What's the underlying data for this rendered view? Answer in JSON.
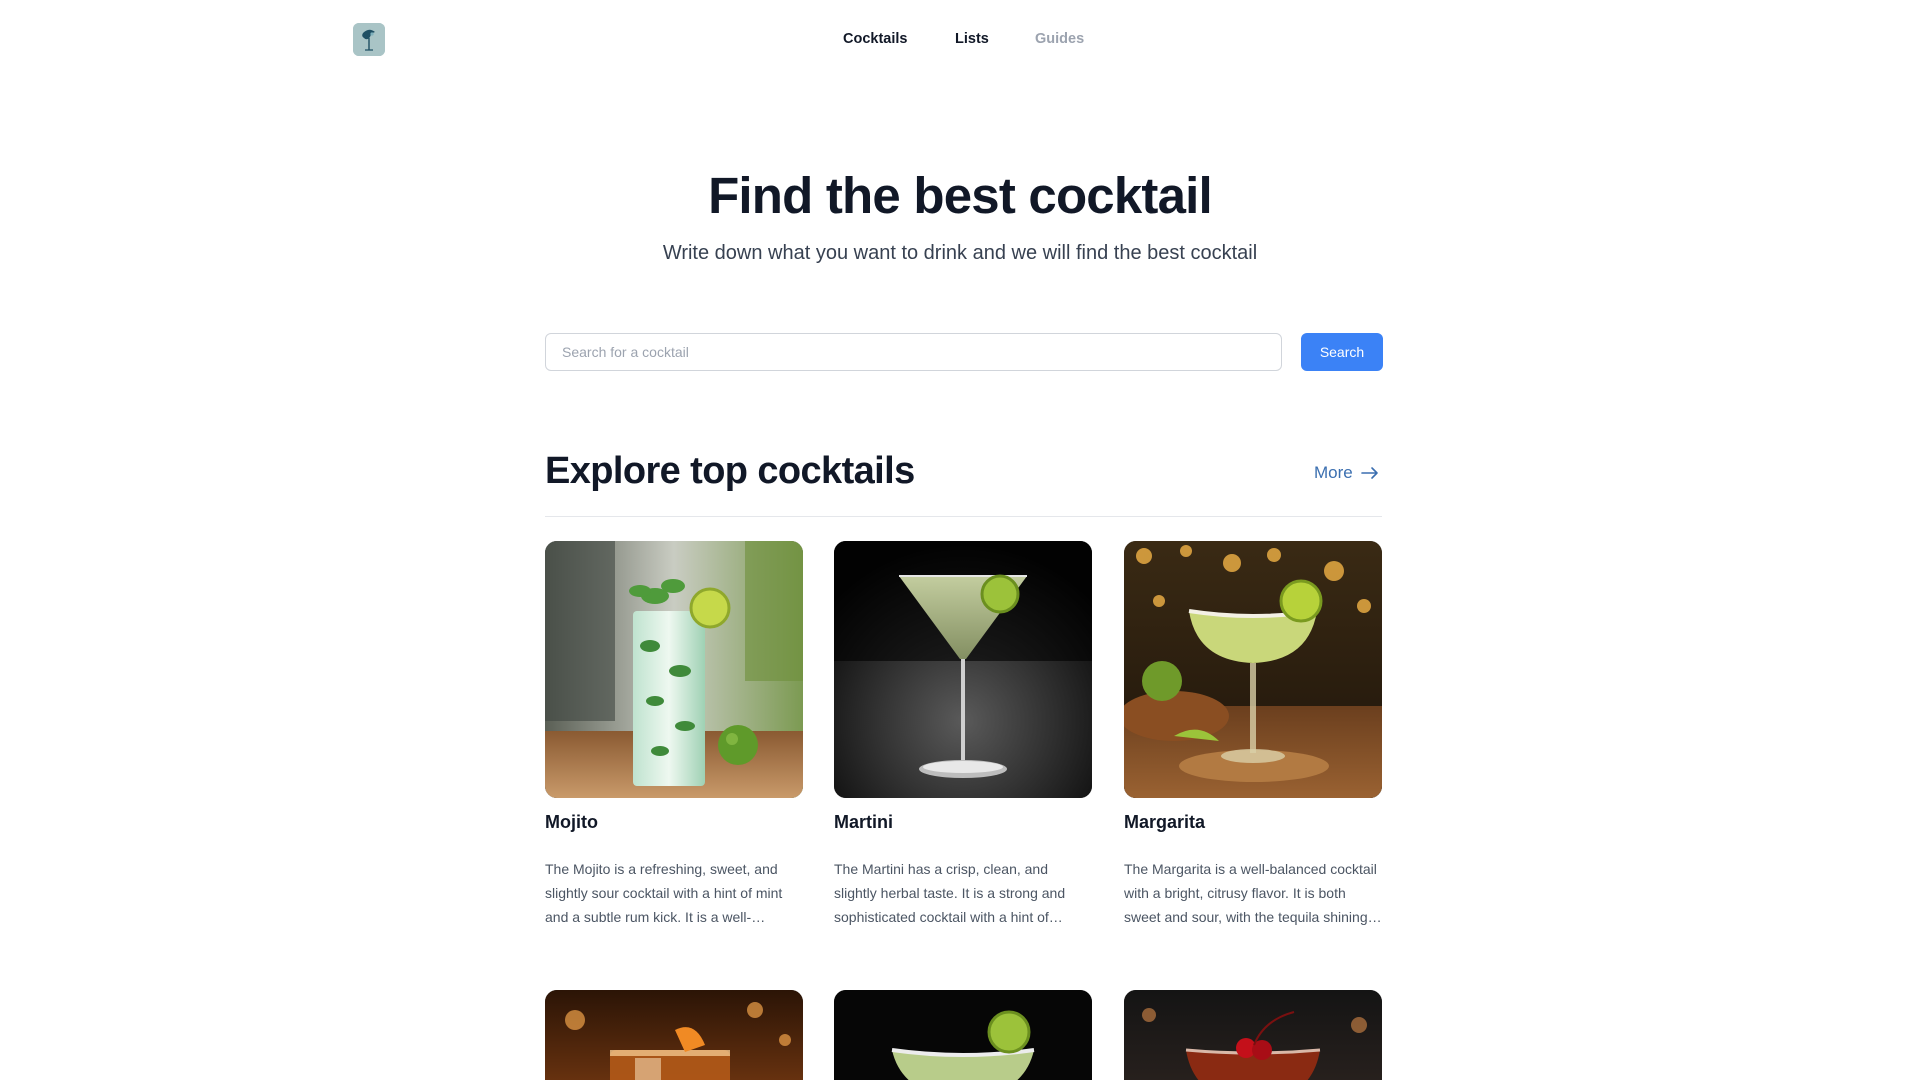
{
  "nav": {
    "items": [
      {
        "label": "Cocktails"
      },
      {
        "label": "Lists"
      },
      {
        "label": "Guides"
      }
    ]
  },
  "hero": {
    "title": "Find the best cocktail",
    "subtitle": "Write down what you want to drink and we will find the best cocktail"
  },
  "search": {
    "placeholder": "Search for a cocktail",
    "value": "",
    "button_label": "Search"
  },
  "section": {
    "title": "Explore top cocktails",
    "more_label": "More",
    "more_icon": "arrow-right-icon"
  },
  "cocktails": [
    {
      "name": "Mojito",
      "description": "The Mojito is a refreshing, sweet, and slightly sour cocktail with a hint of mint and a subtle rum kick. It is a well-balanced and refreshing drink.",
      "image": "mojito-photo"
    },
    {
      "name": "Martini",
      "description": "The Martini has a crisp, clean, and slightly herbal taste. It is a strong and sophisticated cocktail with a hint of dryness.",
      "image": "martini-photo"
    },
    {
      "name": "Margarita",
      "description": "The Margarita is a well-balanced cocktail with a bright, citrusy flavor. It is both sweet and sour, with the tequila shining through.",
      "image": "margarita-photo"
    },
    {
      "image": "old-fashioned-photo"
    },
    {
      "image": "daiquiri-photo"
    },
    {
      "image": "manhattan-photo"
    }
  ],
  "colors": {
    "accent": "#3b82f6",
    "link": "#3b6fb0",
    "text": "#111827",
    "muted": "#9ca3af"
  }
}
